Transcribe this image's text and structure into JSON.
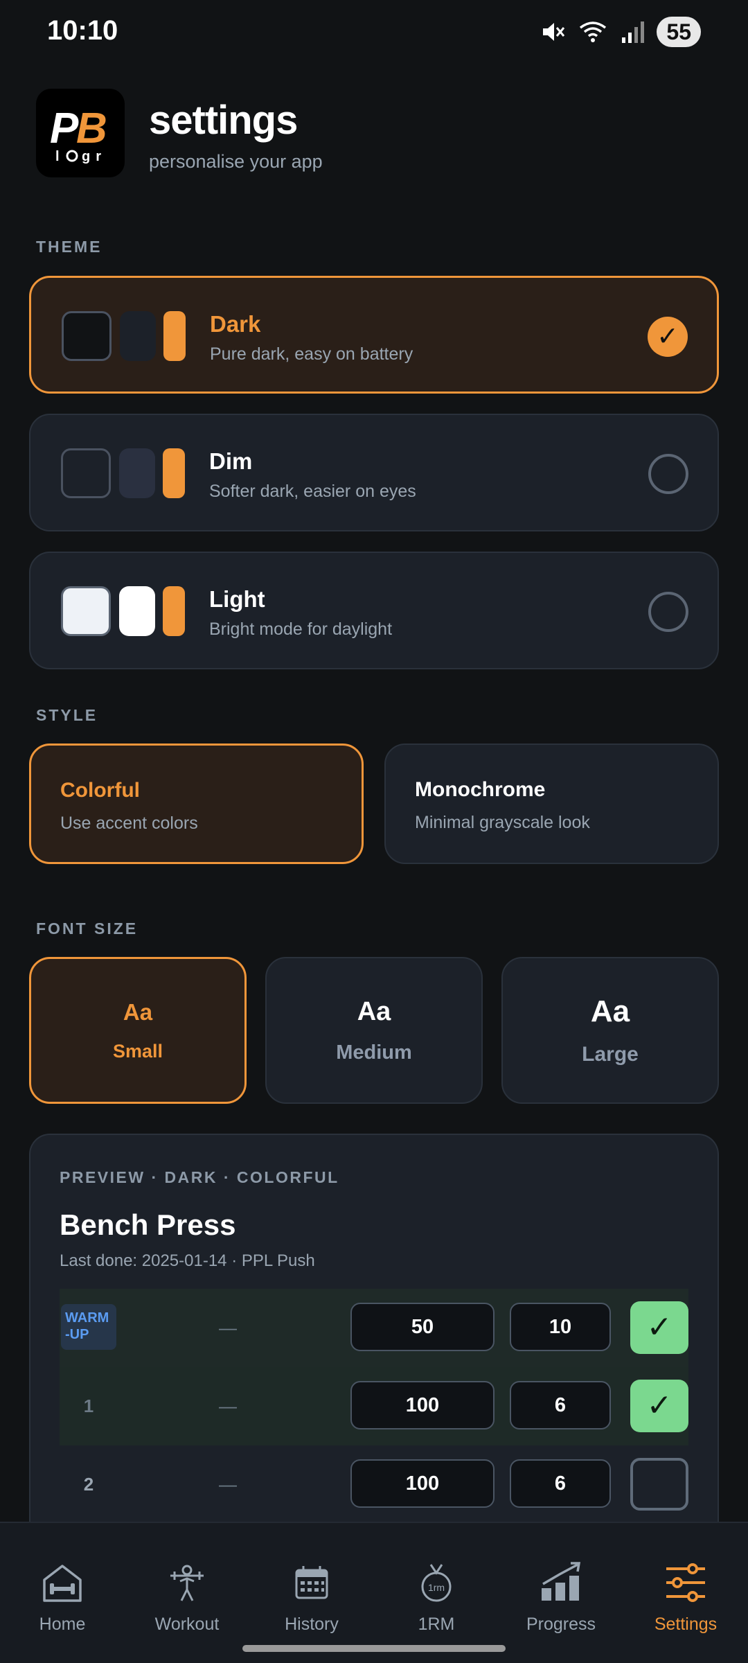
{
  "status_bar": {
    "time": "10:10",
    "battery": "55",
    "icons": [
      "mute-icon",
      "wifi-icon",
      "signal-icon",
      "battery-icon"
    ]
  },
  "header": {
    "logo_text_top": "PB",
    "logo_text_bottom": "l gr",
    "title": "settings",
    "subtitle": "personalise your app"
  },
  "theme": {
    "section_label": "THEME",
    "options": [
      {
        "name": "Dark",
        "description": "Pure dark, easy on battery",
        "selected": true,
        "swatch_bg": "#111315",
        "swatch_surface": "#1c2129",
        "accent": "#f0963a"
      },
      {
        "name": "Dim",
        "description": "Softer dark, easier on eyes",
        "selected": false,
        "swatch_bg": "#1c2129",
        "swatch_surface": "#2a3040",
        "accent": "#f0963a"
      },
      {
        "name": "Light",
        "description": "Bright mode for daylight",
        "selected": false,
        "swatch_bg": "#eef2f7",
        "swatch_surface": "#ffffff",
        "accent": "#f0963a"
      }
    ],
    "check_glyph": "✓"
  },
  "style": {
    "section_label": "STYLE",
    "options": [
      {
        "name": "Colorful",
        "description": "Use accent colors",
        "selected": true
      },
      {
        "name": "Monochrome",
        "description": "Minimal grayscale look",
        "selected": false
      }
    ]
  },
  "font_size": {
    "section_label": "FONT SIZE",
    "options": [
      {
        "sample": "Aa",
        "label": "Small",
        "selected": true
      },
      {
        "sample": "Aa",
        "label": "Medium",
        "selected": false
      },
      {
        "sample": "Aa",
        "label": "Large",
        "selected": false
      }
    ]
  },
  "preview": {
    "label": "PREVIEW · DARK · COLORFUL",
    "exercise": "Bench Press",
    "last_done": "Last done: 2025-01-14 · PPL Push",
    "sets": [
      {
        "set": "WARM\n-UP",
        "previous": "—",
        "weight": "50",
        "reps": "10",
        "done": true
      },
      {
        "set": "1",
        "previous": "—",
        "weight": "100",
        "reps": "6",
        "done": true
      },
      {
        "set": "2",
        "previous": "—",
        "weight": "100",
        "reps": "6",
        "done": false
      }
    ],
    "check_glyph": "✓"
  },
  "bottom_nav": {
    "items": [
      {
        "label": "Home",
        "icon": "home-icon",
        "active": false
      },
      {
        "label": "Workout",
        "icon": "workout-icon",
        "active": false
      },
      {
        "label": "History",
        "icon": "calendar-icon",
        "active": false
      },
      {
        "label": "1RM",
        "icon": "one-rep-max-icon",
        "active": false
      },
      {
        "label": "Progress",
        "icon": "progress-chart-icon",
        "active": false
      },
      {
        "label": "Settings",
        "icon": "sliders-icon",
        "active": true
      }
    ]
  },
  "colors": {
    "accent": "#f0963a",
    "background": "#111315",
    "card": "#1c2129",
    "success": "#7bd88f",
    "warmup_text": "#5b9cf2"
  }
}
